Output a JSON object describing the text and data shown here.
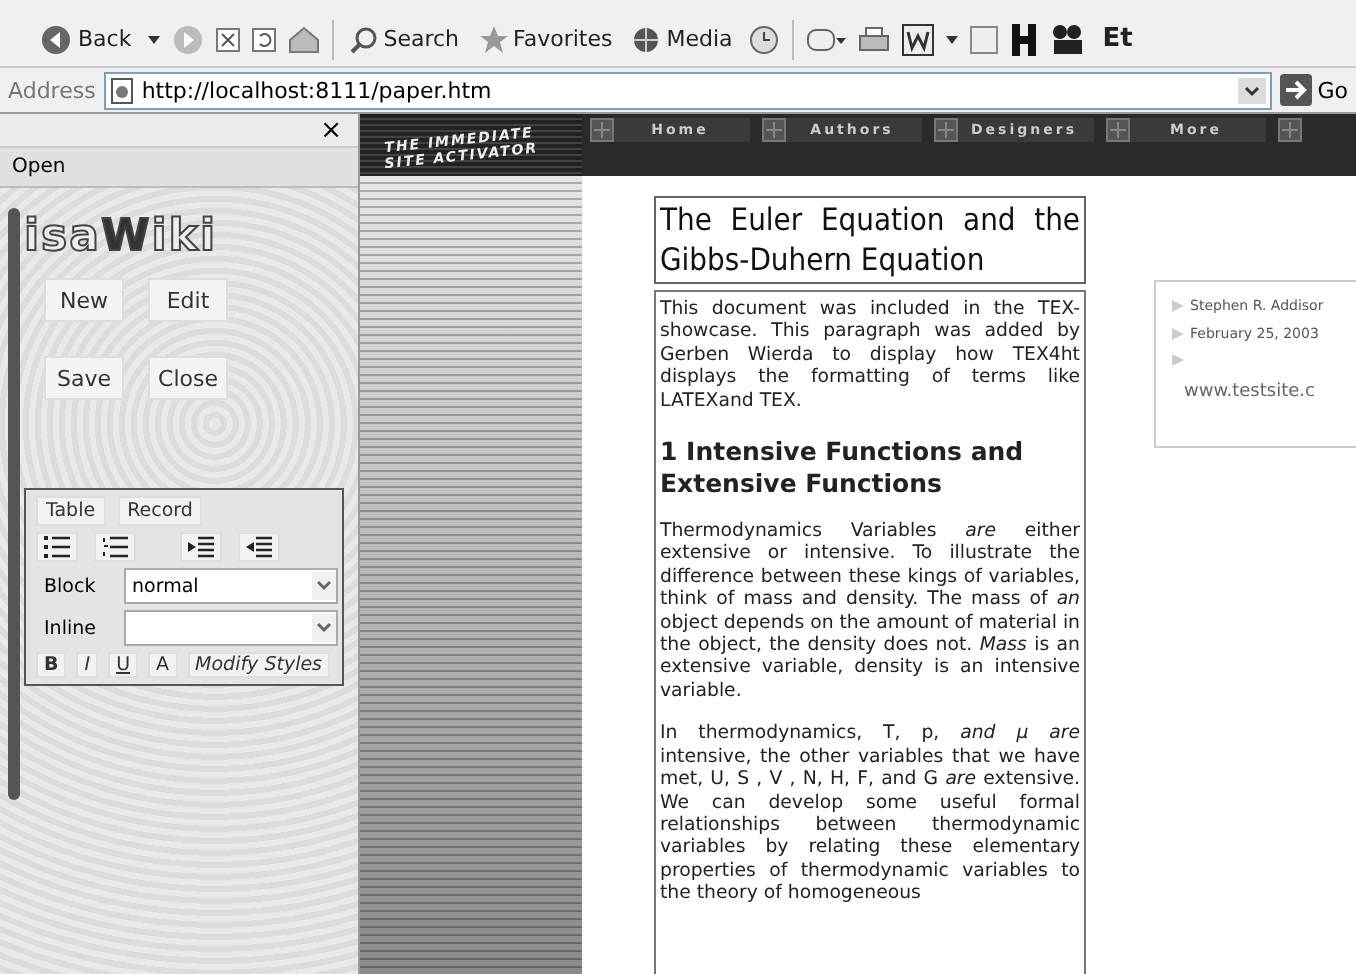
{
  "toolbar": {
    "back": "Back",
    "search": "Search",
    "favorites": "Favorites",
    "media": "Media",
    "extra": "Et"
  },
  "address": {
    "label": "Address",
    "url": "http://localhost:8111/paper.htm",
    "go": "Go"
  },
  "wiki_panel": {
    "close": "×",
    "menu": "Open",
    "logo": "isa**W**iki",
    "buttons": [
      "New",
      "Edit",
      "Save",
      "Close"
    ],
    "editor": {
      "tabs": [
        "Table",
        "Record"
      ],
      "block": {
        "label": "Block",
        "value": "normal"
      },
      "inline": {
        "label": "Inline"
      },
      "format_buttons": [
        "B",
        "I",
        "U",
        "A"
      ],
      "modify": "Modify Styles"
    }
  },
  "site": {
    "logo": [
      "THE IMMEDIATE",
      "SITE ACTIVATOR"
    ],
    "nav": [
      "Home",
      "Authors",
      "Designers",
      "More"
    ],
    "article": {
      "title": "The Euler Equation and the Gibbs-Duhern Equation",
      "intro": "This document was included in the TEX-showcase. This paragraph was added by Gerben Wierda to display how TEX4ht displays the formatting of terms like LATEXand TEX.",
      "heading": "1 Intensive Functions and Extensive Functions",
      "paragraphs": [
        "Thermodynamics Variables *are* either extensive or intensive. To illustrate the difference between these kings of variables, think of mass and density. The mass of *an* object depends on the amount of material in the object, the density does not. *Mass* is an extensive variable, density is an intensive variable.",
        "In thermodynamics, T, p, *and μ are* intensive, the other variables that we have met, U, S , V , N, H, F, and G *are* extensive. We can develop some useful formal relationships between thermodynamic variables by relating these elementary properties of thermodynamic variables to the theory of homogeneous"
      ]
    },
    "info": {
      "items": [
        {
          "kind": "text",
          "text": "Stephen R. Addisor"
        },
        {
          "kind": "text",
          "text": "February 25, 2003"
        },
        {
          "kind": "blank"
        }
      ],
      "link": "www.testsite.c"
    }
  }
}
